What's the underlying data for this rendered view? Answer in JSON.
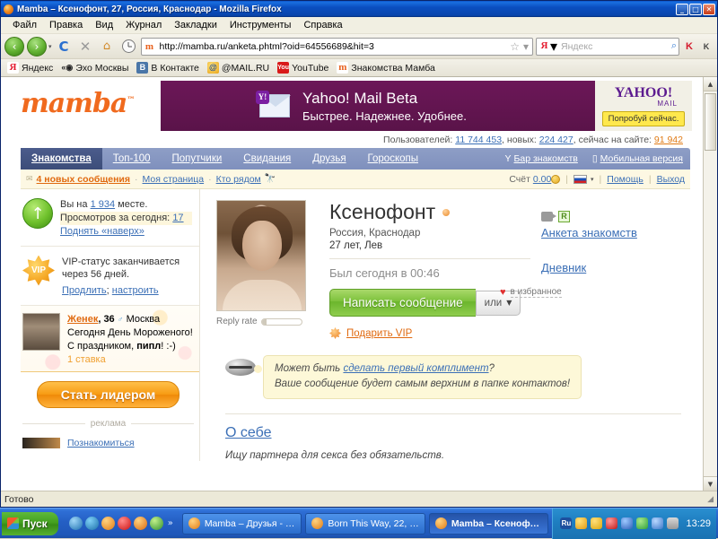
{
  "window": {
    "title": "Mamba – Ксенофонт, 27, Россия, Краснодар - Mozilla Firefox",
    "minimize": "_",
    "maximize": "□",
    "close": "✕"
  },
  "menubar": {
    "items": [
      "Файл",
      "Правка",
      "Вид",
      "Журнал",
      "Закладки",
      "Инструменты",
      "Справка"
    ]
  },
  "toolbar": {
    "back": "‹",
    "forward": "›",
    "dropdown": "▾",
    "reload": "C",
    "stop": "✕",
    "home": "⌂",
    "url": "http://mamba.ru/anketa.phtml?oid=64556689&hit=3",
    "favicon_letter": "m",
    "bookmark_star": "☆",
    "star_caret": "▾",
    "search_engine_letter": "Я",
    "search_placeholder": "Яндекс",
    "search_magnifier": "⌕",
    "extra_icon_1": "K",
    "extra_icon_2": "K"
  },
  "bookmarks": [
    {
      "label": "Яндекс",
      "icon": "yandex-icon",
      "glyph": "Я"
    },
    {
      "label": "Эхо Москвы",
      "icon": "echo-icon",
      "glyph": "«◉"
    },
    {
      "label": "В Контакте",
      "icon": "vk-icon",
      "glyph": "В"
    },
    {
      "label": "@MAIL.RU",
      "icon": "mailru-icon",
      "glyph": "@"
    },
    {
      "label": "YouTube",
      "icon": "youtube-icon",
      "glyph": "You"
    },
    {
      "label": "Знакомства Мамба",
      "icon": "mamba-icon",
      "glyph": "m"
    }
  ],
  "site": {
    "logo": "mamba",
    "logo_tm": "™",
    "banner": {
      "title": "Yahoo! Mail Beta",
      "subtitle": "Быстрее. Надежнее. Удобнее.",
      "yahoo_logo": "YAHOO!",
      "yahoo_mail": "MAIL",
      "cta": "Попробуй сейчас."
    },
    "stats": {
      "users_label": "Пользователей:",
      "users_value": "11 744 453",
      "new_label": "новых:",
      "new_value": "224 427",
      "online_label": "сейчас на сайте:",
      "online_value": "91 942"
    },
    "nav": {
      "tabs": [
        {
          "label": "Знакомства",
          "active": true
        },
        {
          "label": "Топ-100",
          "active": false
        },
        {
          "label": "Попутчики",
          "active": false
        },
        {
          "label": "Свидания",
          "active": false
        },
        {
          "label": "Друзья",
          "active": false
        },
        {
          "label": "Гороскопы",
          "active": false
        }
      ],
      "right": [
        {
          "label": "Бар знакомств",
          "icon": "cocktail-icon",
          "glyph": "Y"
        },
        {
          "label": "Мобильная версия",
          "icon": "mobile-icon",
          "glyph": "▯"
        }
      ]
    },
    "subbar": {
      "mail_icon": "envelope-icon",
      "messages": "4 новых сообщения",
      "my_page": "Моя страница",
      "who_near": "Кто рядом",
      "binoculars_icon": "binoculars-icon",
      "dot": "·",
      "balance_label": "Счёт",
      "balance_value": "0.00",
      "coin_icon": "coin-icon",
      "flag_icon": "russia-flag-icon",
      "flag_caret": "▾",
      "help": "Помощь",
      "logout": "Выход"
    }
  },
  "sidebar": {
    "rank": {
      "icon": "green-up-arrow-icon",
      "prefix": "Вы на",
      "place_value": "1 934",
      "suffix": "месте.",
      "views_label": "Просмотров за сегодня:",
      "views_value": "17",
      "boost_link": "Поднять «наверх»"
    },
    "vip": {
      "icon": "vip-star-icon",
      "badge_text": "VIP",
      "text": "VIP-статус заканчивается через 56 дней.",
      "extend_link": "Продлить",
      "separator": ";",
      "settings_link": "настроить"
    },
    "promo": {
      "avatar": "user-avatar",
      "name": "Женек",
      "age": ", 36",
      "gender_icon": "male-icon",
      "city": "Москва",
      "line1": "Сегодня День Мороженого!",
      "line2_a": "С праздником, ",
      "line2_b": "пипл",
      "line2_c": "! :-)",
      "stake": "1 ставка"
    },
    "leader_button": "Стать лидером",
    "ad_label": "реклама",
    "ad_link": "Познакомиться"
  },
  "profile": {
    "photo": "profile-photo",
    "reply_rate_label": "Reply rate",
    "name": "Ксенофонт",
    "online_dot": "online-status-icon",
    "location": "Россия, Краснодар",
    "age_sign": "27 лет, Лев",
    "last_seen": "Был сегодня в 00:46",
    "message_button": "Написать сообщение",
    "or_label": "или",
    "or_caret": "▼",
    "gift_icon": "gift-star-icon",
    "gift_link": "Подарить VIP",
    "icons": {
      "camera": "camera-icon",
      "rating": "R"
    },
    "links": {
      "questionnaire": "Анкета знакомств",
      "diary": "Дневник"
    },
    "favorite": {
      "heart_icon": "heart-icon",
      "label": "в избранное"
    }
  },
  "compliment": {
    "lips_icon": "lips-icon",
    "line1_a": "Может быть ",
    "line1_link": "сделать первый комплимент",
    "line1_b": "?",
    "line2": "Ваше сообщение будет самым верхним в папке контактов!"
  },
  "about": {
    "heading": "О себе",
    "text": "Ищу партнера для секса без обязательств."
  },
  "statusbar": {
    "text": "Готово",
    "grip": "◢"
  },
  "taskbar": {
    "start": "Пуск",
    "quicklaunch_overflow": "»",
    "tasks": [
      {
        "label": "Mamba – Друзья - Mozil...",
        "active": false
      },
      {
        "label": "Born This Way, 22, Крас...",
        "active": false
      },
      {
        "label": "Mamba – Ксенофонт...",
        "active": true
      }
    ],
    "tray_lang": "Ru",
    "clock": "13:29"
  },
  "scrollbar": {
    "up": "▲",
    "down": "▼"
  },
  "colors": {
    "accent_orange": "#f06a1e",
    "link_blue": "#3b6fb6",
    "nav_blue": "#7f90bd",
    "green_button": "#7cc13b",
    "banner_purple": "#6c1758"
  }
}
